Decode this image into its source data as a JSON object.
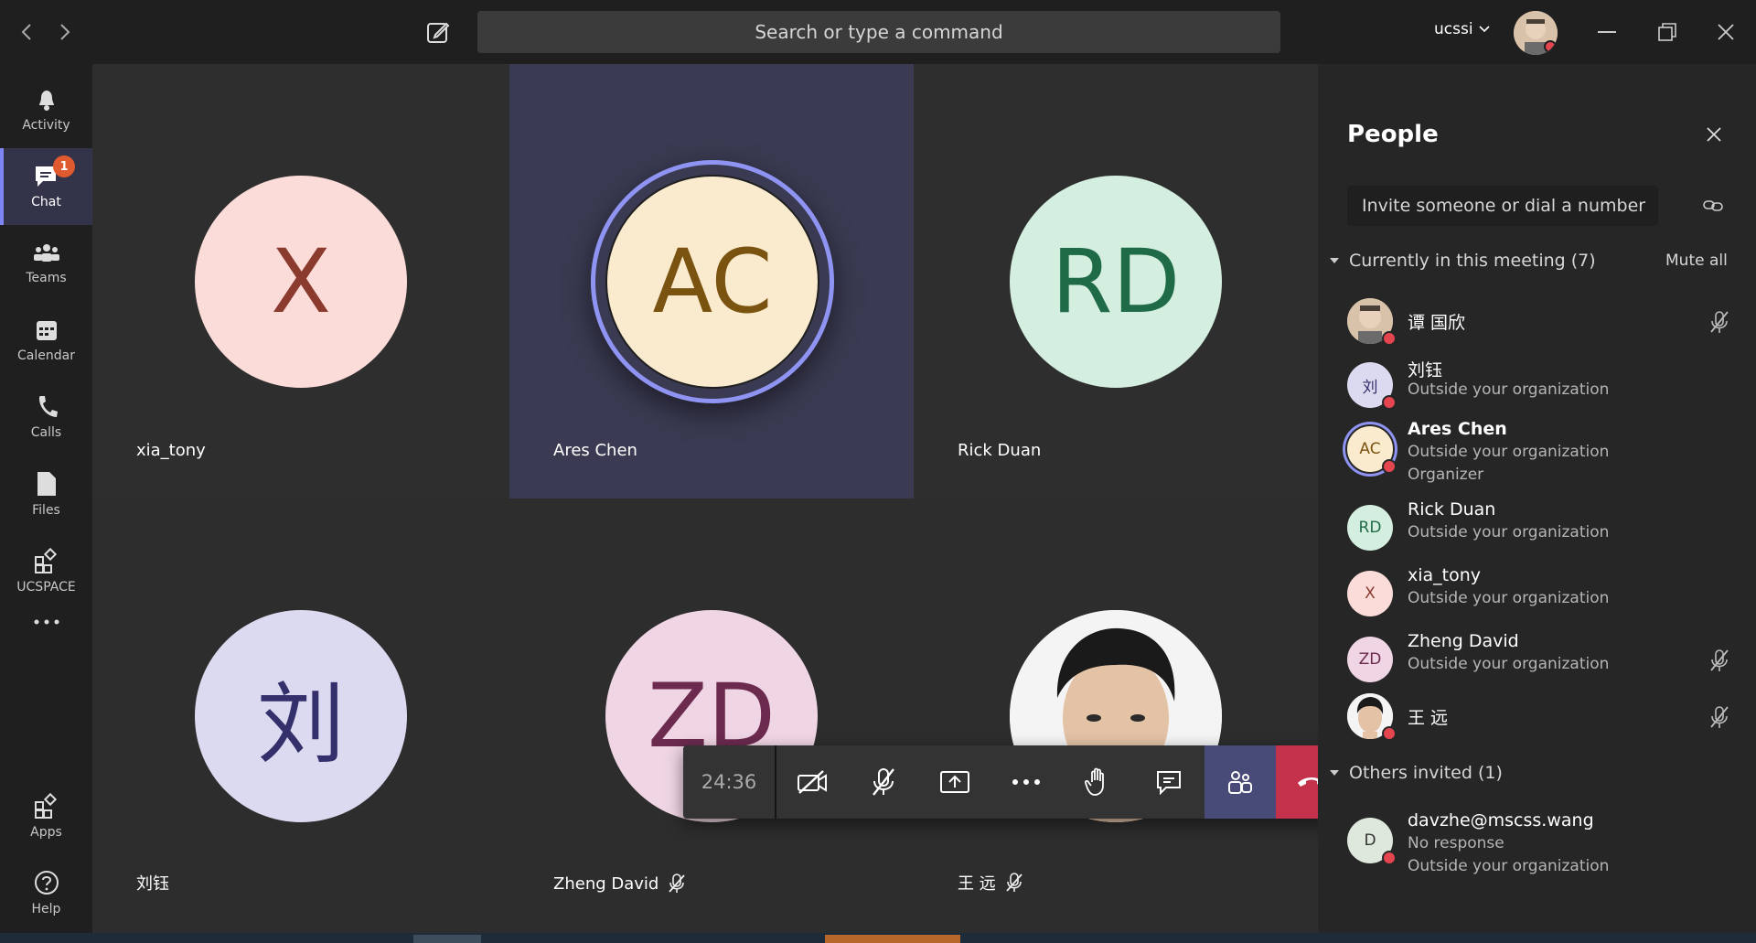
{
  "titlebar": {
    "search_placeholder": "Search or type a command",
    "user_name": "ucssi"
  },
  "rail": [
    {
      "label": "Activity",
      "icon": "bell-icon"
    },
    {
      "label": "Chat",
      "icon": "chat-icon",
      "badge": "1",
      "active": true
    },
    {
      "label": "Teams",
      "icon": "teams-icon"
    },
    {
      "label": "Calendar",
      "icon": "calendar-icon"
    },
    {
      "label": "Calls",
      "icon": "phone-icon"
    },
    {
      "label": "Files",
      "icon": "file-icon"
    },
    {
      "label": "UCSPACE",
      "icon": "apps-icon"
    },
    {
      "label": "Apps",
      "icon": "apps-icon"
    },
    {
      "label": "Help",
      "icon": "help-icon"
    }
  ],
  "tiles": [
    {
      "name": "xia_tony",
      "initials": "X",
      "bg": "#fbdcd8",
      "fg": "#8b3a2e"
    },
    {
      "name": "Ares Chen",
      "initials": "AC",
      "bg": "#faebcf",
      "fg": "#7a5310"
    },
    {
      "name": "Rick Duan",
      "initials": "RD",
      "bg": "#d4efe0",
      "fg": "#1f6b48"
    },
    {
      "name": "刘钰",
      "initials": "刘",
      "bg": "#dcdaf0",
      "fg": "#33306b"
    },
    {
      "name": "Zheng David",
      "initials": "ZD",
      "bg": "#f0d6e4",
      "fg": "#6b2a4e"
    },
    {
      "name": "王 远",
      "initials": "",
      "bg": "#f2f2f2",
      "fg": "#333"
    }
  ],
  "controls": {
    "timer": "24:36"
  },
  "panel": {
    "title": "People",
    "invite_placeholder": "Invite someone or dial a number",
    "current_section": "Currently in this meeting (7)",
    "mute_all": "Mute all",
    "others_section": "Others invited (1)",
    "people": [
      {
        "name": "谭 国欣",
        "sub1": "",
        "sub2": "",
        "initials": "",
        "bg": "#c9b19a",
        "fg": "#333",
        "muted": true,
        "bold": false
      },
      {
        "name": "刘钰",
        "sub1": "Outside your organization",
        "sub2": "",
        "initials": "刘",
        "bg": "#dcdaf0",
        "fg": "#33306b",
        "muted": false,
        "bold": false
      },
      {
        "name": "Ares Chen",
        "sub1": "Outside your organization",
        "sub2": "Organizer",
        "initials": "AC",
        "bg": "#faebcf",
        "fg": "#7a5310",
        "muted": false,
        "bold": true
      },
      {
        "name": "Rick Duan",
        "sub1": "Outside your organization",
        "sub2": "",
        "initials": "RD",
        "bg": "#d4efe0",
        "fg": "#1f6b48",
        "muted": false,
        "bold": false
      },
      {
        "name": "xia_tony",
        "sub1": "Outside your organization",
        "sub2": "",
        "initials": "X",
        "bg": "#fbdcd8",
        "fg": "#8b3a2e",
        "muted": false,
        "bold": false
      },
      {
        "name": "Zheng David",
        "sub1": "Outside your organization",
        "sub2": "",
        "initials": "ZD",
        "bg": "#f0d6e4",
        "fg": "#6b2a4e",
        "muted": true,
        "bold": false
      },
      {
        "name": "王 远",
        "sub1": "",
        "sub2": "",
        "initials": "",
        "bg": "#f2f2f2",
        "fg": "#333",
        "muted": true,
        "bold": false
      }
    ],
    "invited": [
      {
        "name": "davzhe@mscss.wang",
        "sub1": "No response",
        "sub2": "Outside your organization",
        "initials": "D",
        "bg": "#dfe8dc",
        "fg": "#333"
      }
    ]
  }
}
